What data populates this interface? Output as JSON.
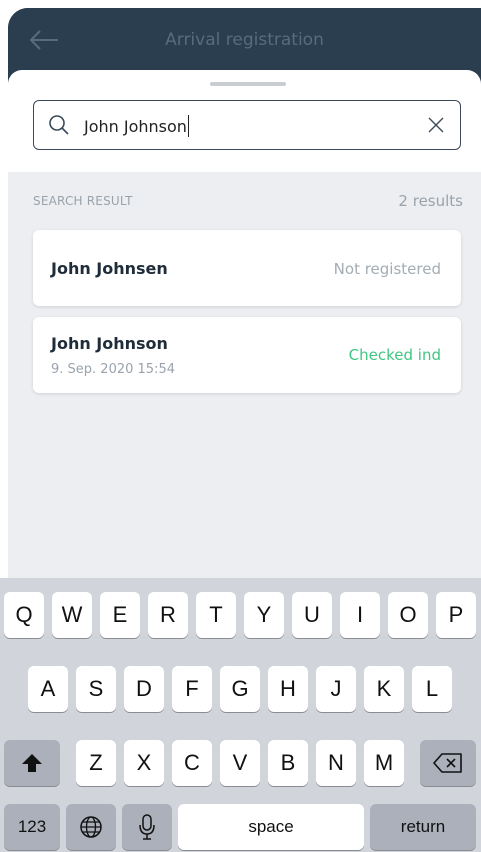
{
  "header": {
    "title": "Arrival registration"
  },
  "search": {
    "value": "John Johnson",
    "placeholder": ""
  },
  "results": {
    "header_label": "SEARCH RESULT",
    "count_label": "2 results",
    "items": [
      {
        "name": "John Johnsen",
        "date": "",
        "status": "Not registered",
        "status_color": "#a4acb4"
      },
      {
        "name": "John Johnson",
        "date": "9. Sep. 2020 15:54",
        "status": "Checked ind",
        "status_color": "#40c682"
      }
    ]
  },
  "keyboard": {
    "row1": [
      "Q",
      "W",
      "E",
      "R",
      "T",
      "Y",
      "U",
      "I",
      "O",
      "P"
    ],
    "row2": [
      "A",
      "S",
      "D",
      "F",
      "G",
      "H",
      "J",
      "K",
      "L"
    ],
    "row3": [
      "Z",
      "X",
      "C",
      "V",
      "B",
      "N",
      "M"
    ],
    "numbers_label": "123",
    "space_label": "space",
    "return_label": "return"
  },
  "colors": {
    "topbar": "#2b3e50",
    "accent_green": "#40c682",
    "background": "#eceef1"
  },
  "icons": [
    "back-arrow-icon",
    "search-icon",
    "clear-icon",
    "shift-icon",
    "backspace-icon",
    "globe-icon",
    "microphone-icon"
  ]
}
